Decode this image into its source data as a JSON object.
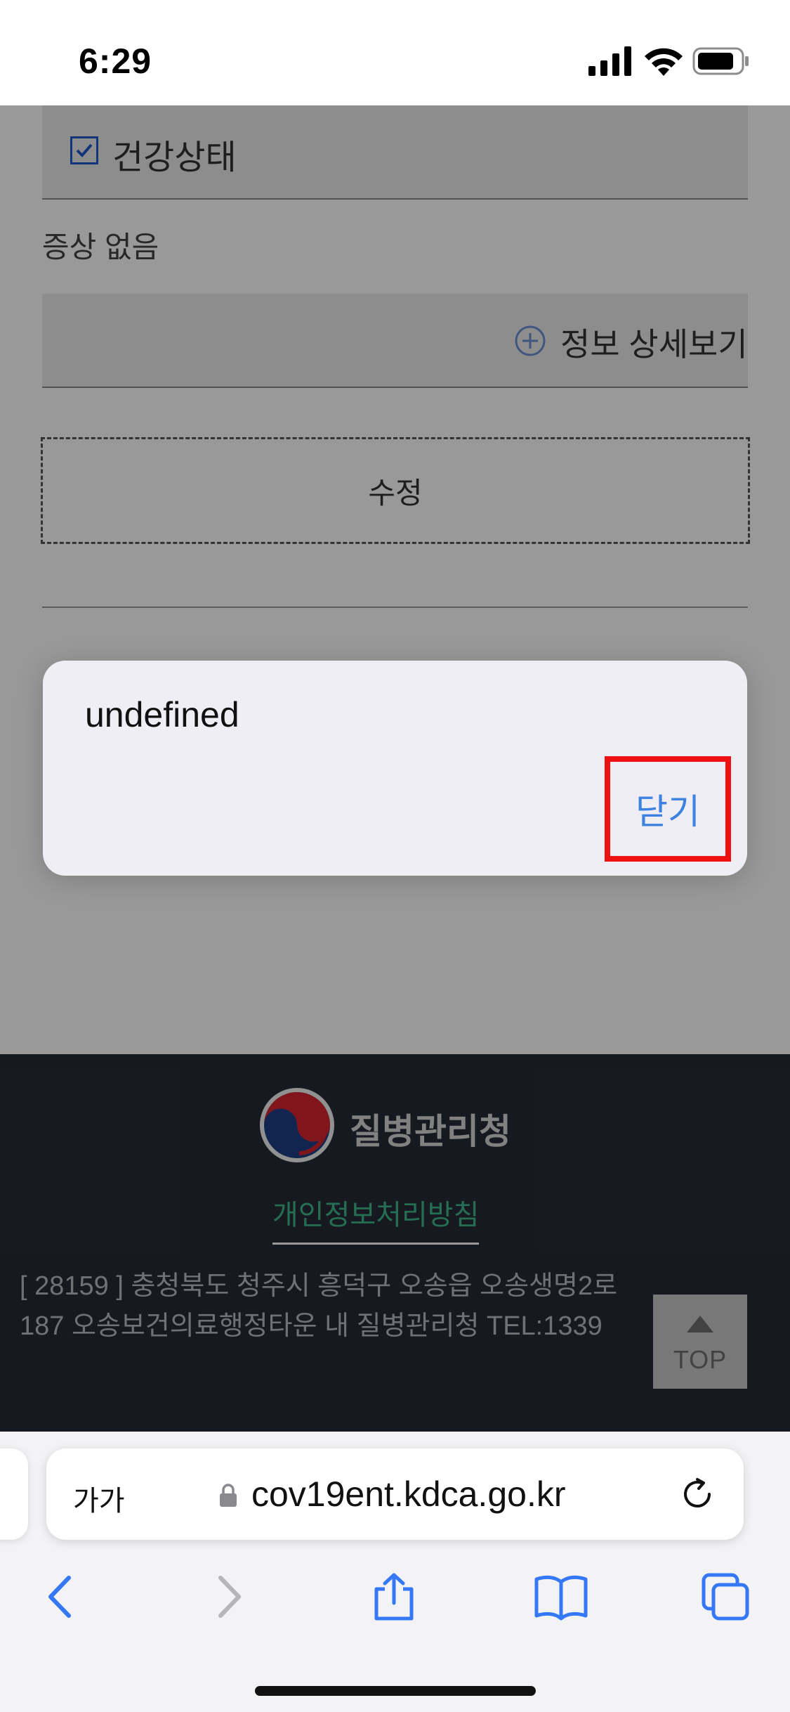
{
  "status_bar": {
    "time": "6:29"
  },
  "page": {
    "health_label": "건강상태",
    "symptom_text": "증상 없음",
    "detail_label": "정보 상세보기",
    "edit_label": "수정"
  },
  "dialog": {
    "message": "undefined",
    "close_label": "닫기"
  },
  "footer": {
    "org_name": "질병관리청",
    "privacy_link": "개인정보처리방침",
    "address": "[ 28159 ] 충청북도 청주시 흥덕구 오송읍 오송생명2로 187 오송보건의료행정타운 내 질병관리청 TEL:1339",
    "top_label": "TOP"
  },
  "browser": {
    "text_size_label": "가가",
    "url": "cov19ent.kdca.go.kr"
  },
  "colors": {
    "accent_blue": "#3d82e0",
    "highlight_red": "#ee1111",
    "footer_bg": "#262b36",
    "privacy_green": "#3fb88d"
  }
}
